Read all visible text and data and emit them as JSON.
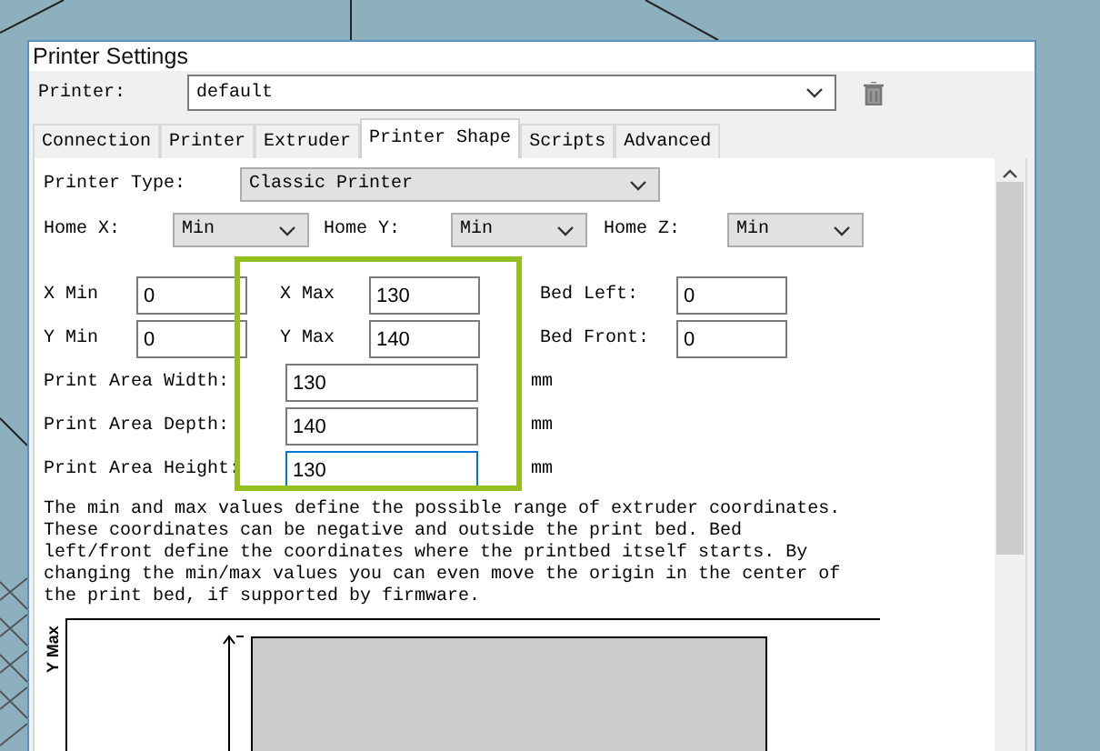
{
  "window": {
    "title": "Printer Settings"
  },
  "printer": {
    "label": "Printer:",
    "value": "default"
  },
  "tabs": [
    {
      "label": "Connection",
      "selected": false
    },
    {
      "label": "Printer",
      "selected": false
    },
    {
      "label": "Extruder",
      "selected": false
    },
    {
      "label": "Printer Shape",
      "selected": true
    },
    {
      "label": "Scripts",
      "selected": false
    },
    {
      "label": "Advanced",
      "selected": false
    }
  ],
  "printer_type": {
    "label": "Printer Type:",
    "value": "Classic Printer"
  },
  "home": [
    {
      "label": "Home X:",
      "value": "Min"
    },
    {
      "label": "Home Y:",
      "value": "Min"
    },
    {
      "label": "Home Z:",
      "value": "Min"
    }
  ],
  "coordinates": [
    [
      {
        "label": "X Min",
        "value": "0"
      },
      {
        "label": "X Max",
        "value": "130"
      },
      {
        "label": "Bed Left:",
        "value": "0"
      }
    ],
    [
      {
        "label": "Y Min",
        "value": "0"
      },
      {
        "label": "Y Max",
        "value": "140"
      },
      {
        "label": "Bed Front:",
        "value": "0"
      }
    ]
  ],
  "print_area": [
    {
      "label": "Print Area Width:",
      "value": "130",
      "unit": "mm",
      "focused": false
    },
    {
      "label": "Print Area Depth:",
      "value": "140",
      "unit": "mm",
      "focused": false
    },
    {
      "label": "Print Area Height:",
      "value": "130",
      "unit": "mm",
      "focused": true
    }
  ],
  "description": "The min and max values define the possible range of extruder coordinates. These coordinates can be negative and outside the print bed. Bed left/front define the coordinates where the printbed itself starts. By changing the min/max values you can even move the origin in the center of the print bed, if supported by firmware.",
  "diagram": {
    "axis_label": "Y Max"
  }
}
